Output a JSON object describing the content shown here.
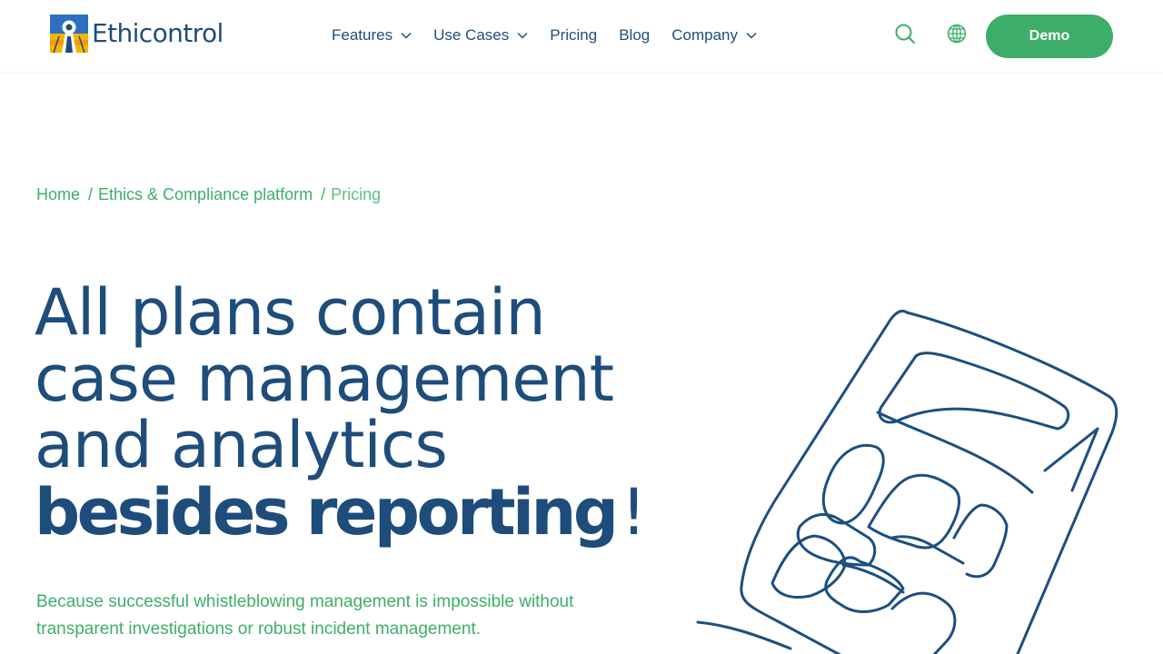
{
  "header": {
    "brand": "Ethicontrol",
    "nav": [
      {
        "label": "Features",
        "has_dropdown": true
      },
      {
        "label": "Use Cases",
        "has_dropdown": true
      },
      {
        "label": "Pricing",
        "has_dropdown": false
      },
      {
        "label": "Blog",
        "has_dropdown": false
      },
      {
        "label": "Company",
        "has_dropdown": true
      }
    ],
    "icons": [
      "search-icon",
      "globe-icon"
    ],
    "cta_label": "Demo"
  },
  "breadcrumb": {
    "items": [
      "Home",
      "Ethics & Compliance platform",
      "Pricing"
    ],
    "separator": "/"
  },
  "hero": {
    "title_lines": [
      "All plans contain",
      "case management",
      "and analytics"
    ],
    "title_bold": "besides reporting",
    "title_end": "!",
    "subtitle": "Because successful whistleblowing management is impossible without transparent investigations or robust incident management."
  },
  "colors": {
    "brand_blue": "#1e4d7b",
    "accent_green": "#3dae69",
    "illustration_stroke": "#1c4f80"
  }
}
